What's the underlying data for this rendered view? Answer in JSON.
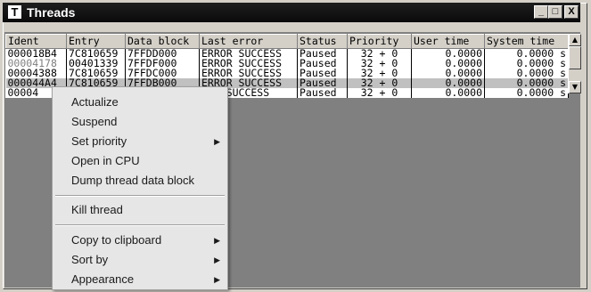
{
  "window": {
    "title": "Threads",
    "icon_letter": "T"
  },
  "title_buttons": {
    "minimize": "_",
    "maximize": "□",
    "close": "X"
  },
  "columns": [
    "Ident",
    "Entry",
    "Data block",
    "Last error",
    "Status",
    "Priority",
    "User time",
    "System time"
  ],
  "rows": [
    {
      "ident": "000018B4",
      "entry": "7C810659",
      "data_block": "7FFDD000",
      "last_error": "ERROR_SUCCESS",
      "status": "Paused",
      "priority": "32 + 0",
      "user_time": "0.0000",
      "system_time": "0.0000 s"
    },
    {
      "ident": "00004178",
      "entry": "00401339",
      "data_block": "7FFDF000",
      "last_error": "ERROR_SUCCESS",
      "status": "Paused",
      "priority": "32 + 0",
      "user_time": "0.0000",
      "system_time": "0.0000 s"
    },
    {
      "ident": "00004388",
      "entry": "7C810659",
      "data_block": "7FFDC000",
      "last_error": "ERROR_SUCCESS",
      "status": "Paused",
      "priority": "32 + 0",
      "user_time": "0.0000",
      "system_time": "0.0000 s"
    },
    {
      "ident": "000044A4",
      "entry": "7C810659",
      "data_block": "7FFDB000",
      "last_error": "ERROR_SUCCESS",
      "status": "Paused",
      "priority": "32 + 0",
      "user_time": "0.0000",
      "system_time": "0.0000 s"
    },
    {
      "ident": "00004",
      "entry": "",
      "data_block": "",
      "last_error": "ROR_SUCCESS",
      "status": "Paused",
      "priority": "32 + 0",
      "user_time": "0.0000",
      "system_time": "0.0000 s"
    }
  ],
  "scrollbar": {
    "up_arrow": "▲",
    "down_arrow": "▼"
  },
  "context_menu": {
    "actualize": "Actualize",
    "suspend": "Suspend",
    "set_priority": "Set priority",
    "open_in_cpu": "Open in CPU",
    "dump_thread_data_block": "Dump thread data block",
    "kill_thread": "Kill thread",
    "copy_to_clipboard": "Copy to clipboard",
    "sort_by": "Sort by",
    "appearance": "Appearance",
    "submenu_arrow": "▶"
  }
}
